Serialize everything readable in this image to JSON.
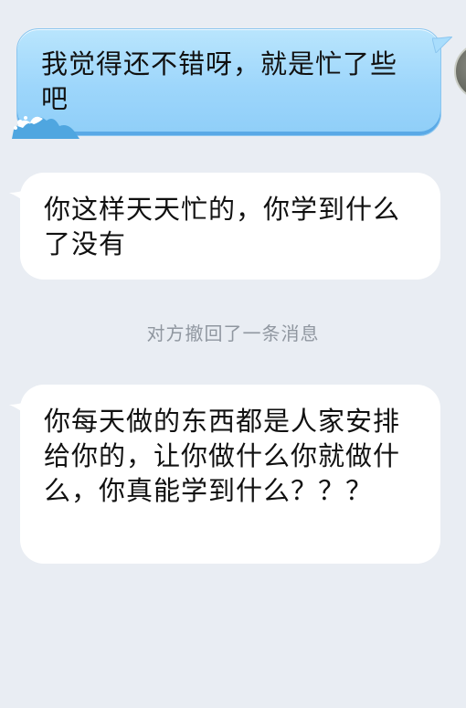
{
  "conversation": {
    "messages": [
      {
        "direction": "outgoing",
        "text": "我觉得还不错呀，就是忙了些吧"
      },
      {
        "direction": "incoming",
        "text": "你这样天天忙的，你学到什么了没有"
      },
      {
        "direction": "incoming",
        "text": "你每天做的东西都是人家安排给你的，让你做什么你就做什么，你真能学到什么？？？"
      }
    ],
    "recall_notice": "对方撤回了一条消息"
  },
  "colors": {
    "background": "#e9edf3",
    "outgoing_bubble": "#9dd6fb",
    "incoming_bubble": "#ffffff",
    "notice_text": "#9097a0"
  },
  "icons": {
    "avatar": "user-avatar",
    "bubble_decoration": "wave-icon"
  }
}
